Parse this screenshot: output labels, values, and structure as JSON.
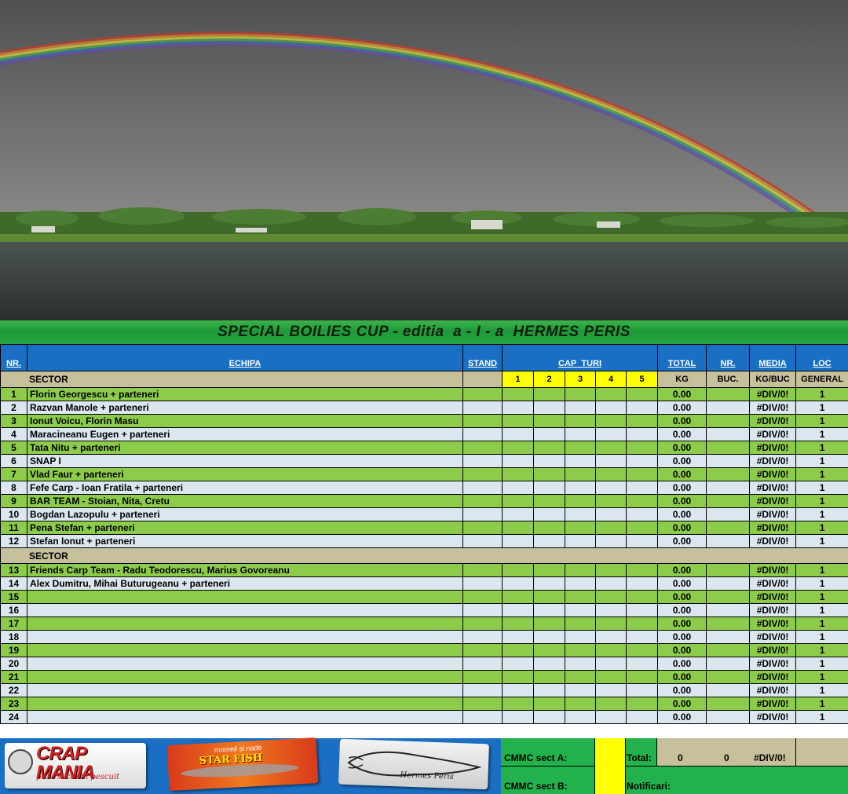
{
  "title": "SPECIAL BOILIES CUP - editia  a - I - a  HERMES PERIS",
  "header": {
    "nr": "NR.",
    "echipa": "ECHIPA",
    "stand": "STAND",
    "cap": "CAP",
    "turi": "TURI",
    "total": "TOTAL",
    "nr2": "NR.",
    "media": "MEDIA",
    "loc": "LOC"
  },
  "subheader": {
    "sector": "SECTOR",
    "rounds": [
      "1",
      "2",
      "3",
      "4",
      "5"
    ],
    "kg": "KG",
    "buc": "BUC.",
    "kgbuc": "KG/BUC",
    "general": "GENERAL"
  },
  "sector2_label": "SECTOR",
  "rows_a": [
    {
      "nr": "1",
      "team": "Florin Georgescu + parteneri",
      "kg": "0.00",
      "media": "#DIV/0!",
      "loc": "1"
    },
    {
      "nr": "2",
      "team": "Razvan Manole + parteneri",
      "kg": "0.00",
      "media": "#DIV/0!",
      "loc": "1"
    },
    {
      "nr": "3",
      "team": "Ionut Voicu, Florin Masu",
      "kg": "0.00",
      "media": "#DIV/0!",
      "loc": "1"
    },
    {
      "nr": "4",
      "team": "Maracineanu Eugen + parteneri",
      "kg": "0.00",
      "media": "#DIV/0!",
      "loc": "1"
    },
    {
      "nr": "5",
      "team": "Tata Nitu + parteneri",
      "kg": "0.00",
      "media": "#DIV/0!",
      "loc": "1"
    },
    {
      "nr": "6",
      "team": "SNAP I",
      "kg": "0.00",
      "media": "#DIV/0!",
      "loc": "1"
    },
    {
      "nr": "7",
      "team": "Vlad Faur + parteneri",
      "kg": "0.00",
      "media": "#DIV/0!",
      "loc": "1"
    },
    {
      "nr": "8",
      "team": "Fefe Carp - Ioan Fratila + parteneri",
      "kg": "0.00",
      "media": "#DIV/0!",
      "loc": "1"
    },
    {
      "nr": "9",
      "team": "BAR TEAM - Stoian, Nita, Cretu",
      "kg": "0.00",
      "media": "#DIV/0!",
      "loc": "1"
    },
    {
      "nr": "10",
      "team": "Bogdan Lazopulu + parteneri",
      "kg": "0.00",
      "media": "#DIV/0!",
      "loc": "1"
    },
    {
      "nr": "11",
      "team": "Pena Stefan + parteneri",
      "kg": "0.00",
      "media": "#DIV/0!",
      "loc": "1"
    },
    {
      "nr": "12",
      "team": "Stefan Ionut + parteneri",
      "kg": "0.00",
      "media": "#DIV/0!",
      "loc": "1"
    }
  ],
  "rows_b": [
    {
      "nr": "13",
      "team": "Friends Carp Team - Radu Teodorescu, Marius Govoreanu",
      "kg": "0.00",
      "media": "#DIV/0!",
      "loc": "1"
    },
    {
      "nr": "14",
      "team": "Alex Dumitru, Mihai Buturugeanu + parteneri",
      "kg": "0.00",
      "media": "#DIV/0!",
      "loc": "1"
    },
    {
      "nr": "15",
      "team": "",
      "kg": "0.00",
      "media": "#DIV/0!",
      "loc": "1"
    },
    {
      "nr": "16",
      "team": "",
      "kg": "0.00",
      "media": "#DIV/0!",
      "loc": "1"
    },
    {
      "nr": "17",
      "team": "",
      "kg": "0.00",
      "media": "#DIV/0!",
      "loc": "1"
    },
    {
      "nr": "18",
      "team": "",
      "kg": "0.00",
      "media": "#DIV/0!",
      "loc": "1"
    },
    {
      "nr": "19",
      "team": "",
      "kg": "0.00",
      "media": "#DIV/0!",
      "loc": "1"
    },
    {
      "nr": "20",
      "team": "",
      "kg": "0.00",
      "media": "#DIV/0!",
      "loc": "1"
    },
    {
      "nr": "21",
      "team": "",
      "kg": "0.00",
      "media": "#DIV/0!",
      "loc": "1"
    },
    {
      "nr": "22",
      "team": "",
      "kg": "0.00",
      "media": "#DIV/0!",
      "loc": "1"
    },
    {
      "nr": "23",
      "team": "",
      "kg": "0.00",
      "media": "#DIV/0!",
      "loc": "1"
    },
    {
      "nr": "24",
      "team": "",
      "kg": "0.00",
      "media": "#DIV/0!",
      "loc": "1"
    }
  ],
  "footer": {
    "cmmc_a": "CMMC sect A:",
    "cmmc_b": "CMMC sect B:",
    "total_label": "Total:",
    "total_kg": "0",
    "total_buc": "0",
    "total_media": "#DIV/0!",
    "notificari": "Notificari:"
  },
  "logos": {
    "crapmania_main": "CRAP MANIA",
    "crapmania_tag": "pro exacta in pescuit",
    "starfish_tag": "momeli si nade",
    "starfish_main": "STAR FISH",
    "hermes": "Hermes Peris"
  },
  "colors": {
    "header_blue": "#1a6fc4",
    "row_green": "#8ccc4a",
    "row_light": "#dbe6ef",
    "sector_tan": "#c6c19a",
    "round_yellow": "#ffff00",
    "footer_green": "#22b14c"
  }
}
